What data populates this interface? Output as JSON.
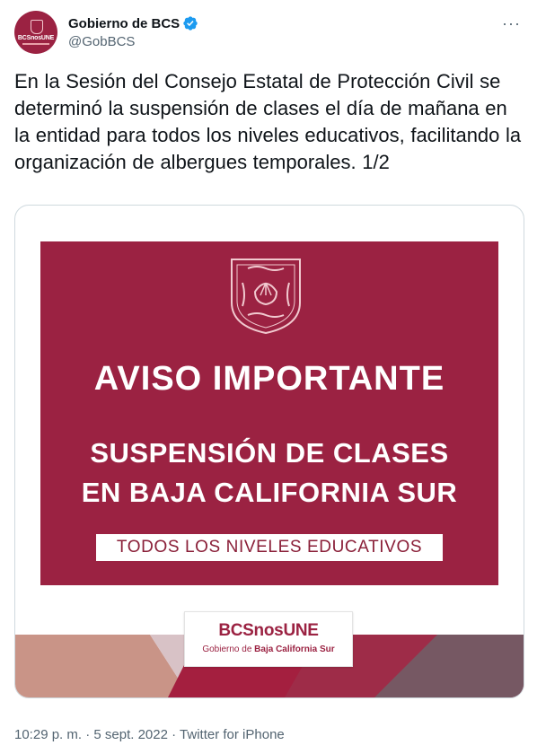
{
  "account": {
    "name": "Gobierno de BCS",
    "handle": "@GobBCS",
    "avatar_text": "BCSnosUNE",
    "verified_icon": "verified-badge-icon",
    "more_icon": "more-options-icon"
  },
  "tweet": {
    "text": "En la Sesión del Consejo Estatal de Protección Civil se determinó la suspensión de clases el día de mañana en la entidad para todos los niveles educativos, facilitando la organización de albergues temporales. 1/2"
  },
  "image": {
    "title": "AVISO IMPORTANTE",
    "subtitle_line1": "SUSPENSIÓN DE CLASES",
    "subtitle_line2": "EN BAJA CALIFORNIA SUR",
    "banner": "TODOS LOS NIVELES EDUCATIVOS",
    "logo_main": "BCSnosUNE",
    "logo_sub_prefix": "Gobierno de ",
    "logo_sub_bold": "Baja California Sur"
  },
  "footer": {
    "time": "10:29 p. m.",
    "separator1": " · ",
    "date": "5 sept. 2022",
    "separator2": " · ",
    "source": "Twitter for iPhone"
  },
  "colors": {
    "brand_maroon": "#9b2242",
    "text_primary": "#0f1419",
    "text_secondary": "#536471",
    "verified_blue": "#1d9bf0",
    "bottom_left": "#c99487",
    "bottom_right": "#765863"
  }
}
